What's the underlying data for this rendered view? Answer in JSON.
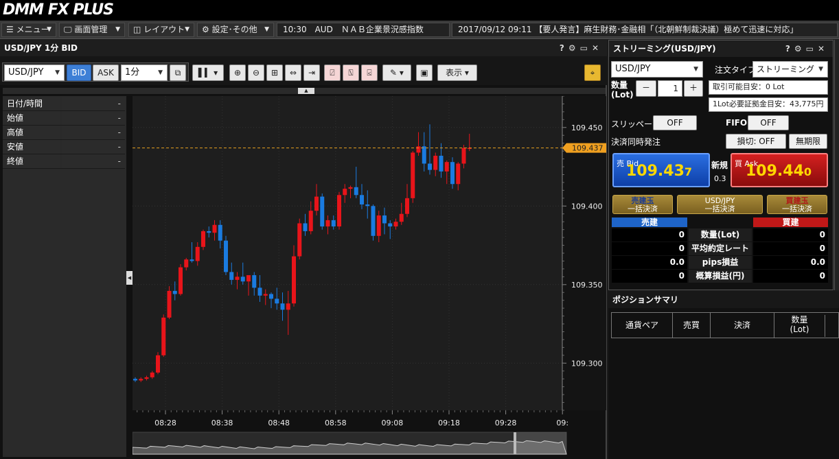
{
  "app": {
    "logo": "DMM FX PLUS"
  },
  "menubar": {
    "menu": "メニュー",
    "screen": "画面管理",
    "layout": "レイアウト",
    "settings": "設定･その他",
    "ticker1": "10:30　AUD　ＮＡＢ企業景況感指数",
    "ticker2": "2017/09/12 09:11 【要人発言】麻生財務･金融相「（北朝鮮制裁決議）極めて迅速に対応」"
  },
  "chart_panel": {
    "title": "USD/JPY 1分 BID",
    "pair": "USD/JPY",
    "bid": "BID",
    "ask": "ASK",
    "interval": "1分",
    "display": "表示",
    "ohlc": [
      {
        "k": "日付/時間",
        "v": "-"
      },
      {
        "k": "始値",
        "v": "-"
      },
      {
        "k": "高値",
        "v": "-"
      },
      {
        "k": "安値",
        "v": "-"
      },
      {
        "k": "終値",
        "v": "-"
      }
    ],
    "current_price": "109.437"
  },
  "chart_data": {
    "type": "candlestick",
    "y_ticks": [
      "109.450",
      "109.400",
      "109.350",
      "109.300"
    ],
    "ylim": [
      109.27,
      109.47
    ],
    "x_ticks": [
      "08:28",
      "08:38",
      "08:48",
      "08:58",
      "09:08",
      "09:18",
      "09:28",
      "09:"
    ],
    "current": 109.437,
    "candles": [
      [
        109.29,
        109.291,
        109.288,
        109.289
      ],
      [
        109.289,
        109.291,
        109.288,
        109.29
      ],
      [
        109.29,
        109.292,
        109.289,
        109.291
      ],
      [
        109.291,
        109.295,
        109.29,
        109.294
      ],
      [
        109.294,
        109.307,
        109.293,
        109.305
      ],
      [
        109.305,
        109.331,
        109.304,
        109.329
      ],
      [
        109.329,
        109.349,
        109.328,
        109.346
      ],
      [
        109.346,
        109.352,
        109.34,
        109.344
      ],
      [
        109.344,
        109.363,
        109.343,
        109.361
      ],
      [
        109.361,
        109.367,
        109.359,
        109.366
      ],
      [
        109.366,
        109.377,
        109.364,
        109.365
      ],
      [
        109.365,
        109.377,
        109.362,
        109.374
      ],
      [
        109.374,
        109.385,
        109.372,
        109.384
      ],
      [
        109.384,
        109.387,
        109.38,
        109.383
      ],
      [
        109.383,
        109.391,
        109.378,
        109.388
      ],
      [
        109.388,
        109.391,
        109.373,
        109.378
      ],
      [
        109.378,
        109.381,
        109.356,
        109.358
      ],
      [
        109.358,
        109.364,
        109.35,
        109.353
      ],
      [
        109.353,
        109.358,
        109.347,
        109.355
      ],
      [
        109.355,
        109.364,
        109.35,
        109.352
      ],
      [
        109.352,
        109.356,
        109.343,
        109.356
      ],
      [
        109.356,
        109.358,
        109.343,
        109.348
      ],
      [
        109.348,
        109.356,
        109.339,
        109.343
      ],
      [
        109.343,
        109.347,
        109.337,
        109.344
      ],
      [
        109.344,
        109.345,
        109.335,
        109.341
      ],
      [
        109.341,
        109.348,
        109.334,
        109.338
      ],
      [
        109.338,
        109.345,
        109.327,
        109.334
      ],
      [
        109.334,
        109.346,
        109.318,
        109.338
      ],
      [
        109.338,
        109.375,
        109.336,
        109.368
      ],
      [
        109.368,
        109.392,
        109.366,
        109.389
      ],
      [
        109.389,
        109.395,
        109.381,
        109.384
      ],
      [
        109.384,
        109.403,
        109.382,
        109.397
      ],
      [
        109.397,
        109.414,
        109.394,
        109.406
      ],
      [
        109.406,
        109.408,
        109.385,
        109.387
      ],
      [
        109.387,
        109.394,
        109.382,
        109.391
      ],
      [
        109.391,
        109.394,
        109.385,
        109.387
      ],
      [
        109.387,
        109.409,
        109.385,
        109.407
      ],
      [
        109.407,
        109.414,
        109.402,
        109.411
      ],
      [
        109.411,
        109.413,
        109.405,
        109.412
      ],
      [
        109.412,
        109.425,
        109.405,
        109.407
      ],
      [
        109.407,
        109.414,
        109.398,
        109.401
      ],
      [
        109.401,
        109.41,
        109.392,
        109.4
      ],
      [
        109.4,
        109.401,
        109.378,
        109.381
      ],
      [
        109.381,
        109.397,
        109.377,
        109.394
      ],
      [
        109.394,
        109.399,
        109.382,
        109.389
      ],
      [
        109.389,
        109.391,
        109.379,
        109.387
      ],
      [
        109.387,
        109.392,
        109.385,
        109.39
      ],
      [
        109.39,
        109.402,
        109.388,
        109.395
      ],
      [
        109.395,
        109.414,
        109.393,
        109.405
      ],
      [
        109.405,
        109.435,
        109.402,
        109.434
      ],
      [
        109.434,
        109.447,
        109.432,
        109.438
      ],
      [
        109.438,
        109.447,
        109.422,
        109.427
      ],
      [
        109.427,
        109.452,
        109.42,
        109.423
      ],
      [
        109.423,
        109.434,
        109.419,
        109.432
      ],
      [
        109.432,
        109.44,
        109.418,
        109.422
      ],
      [
        109.422,
        109.429,
        109.414,
        109.428
      ],
      [
        109.428,
        109.431,
        109.411,
        109.414
      ],
      [
        109.414,
        109.428,
        109.41,
        109.427
      ],
      [
        109.427,
        109.439,
        109.424,
        109.437
      ],
      [
        109.437,
        109.446,
        109.435,
        109.437
      ]
    ]
  },
  "streaming": {
    "title": "ストリーミング(USD/JPY)",
    "pair": "USD/JPY",
    "order_type_label": "注文タイプ",
    "order_type": "ストリーミング",
    "qty_label1": "数量",
    "qty_label2": "(Lot)",
    "qty_minus": "－",
    "qty_value": "1",
    "qty_plus": "＋",
    "available": "取引可能目安：0 Lot",
    "margin": "1Lot必要証拠金目安：43,775円",
    "slippage_label": "スリッページ",
    "slippage": "OFF",
    "fifo_label": "FIFO",
    "fifo": "OFF",
    "settle_label": "決済同時発注",
    "stoploss": "損切: OFF",
    "term": "無期限",
    "bid_label": "売 Bid",
    "bid_big": "109.43",
    "bid_last": "7",
    "spread_label": "新規",
    "spread": "0.3",
    "ask_label": "買 Ask",
    "ask_big": "109.44",
    "ask_last": "0",
    "sell_all_1": "売建玉",
    "sell_all_2": "一括決済",
    "pair_all_1": "USD/JPY",
    "pair_all_2": "一括決済",
    "buy_all_1": "買建玉",
    "buy_all_2": "一括決済",
    "sell_header": "売建",
    "buy_header": "買建",
    "rows": [
      {
        "l": "0",
        "m": "数量(Lot)",
        "r": "0"
      },
      {
        "l": "0",
        "m": "平均約定レート",
        "r": "0"
      },
      {
        "l": "0.0",
        "m": "pips損益",
        "r": "0.0"
      },
      {
        "l": "0",
        "m": "概算損益(円)",
        "r": "0"
      }
    ]
  },
  "summary": {
    "title": "ポジションサマリ",
    "cols": [
      "通貨ペア",
      "売買",
      "決済",
      "数量",
      "(Lot)"
    ]
  },
  "colors": {
    "up": "#e8141a",
    "down": "#1a7be0",
    "bid_bg": "#1455c8",
    "ask_bg": "#b81414",
    "price_yellow": "#ffd800"
  }
}
